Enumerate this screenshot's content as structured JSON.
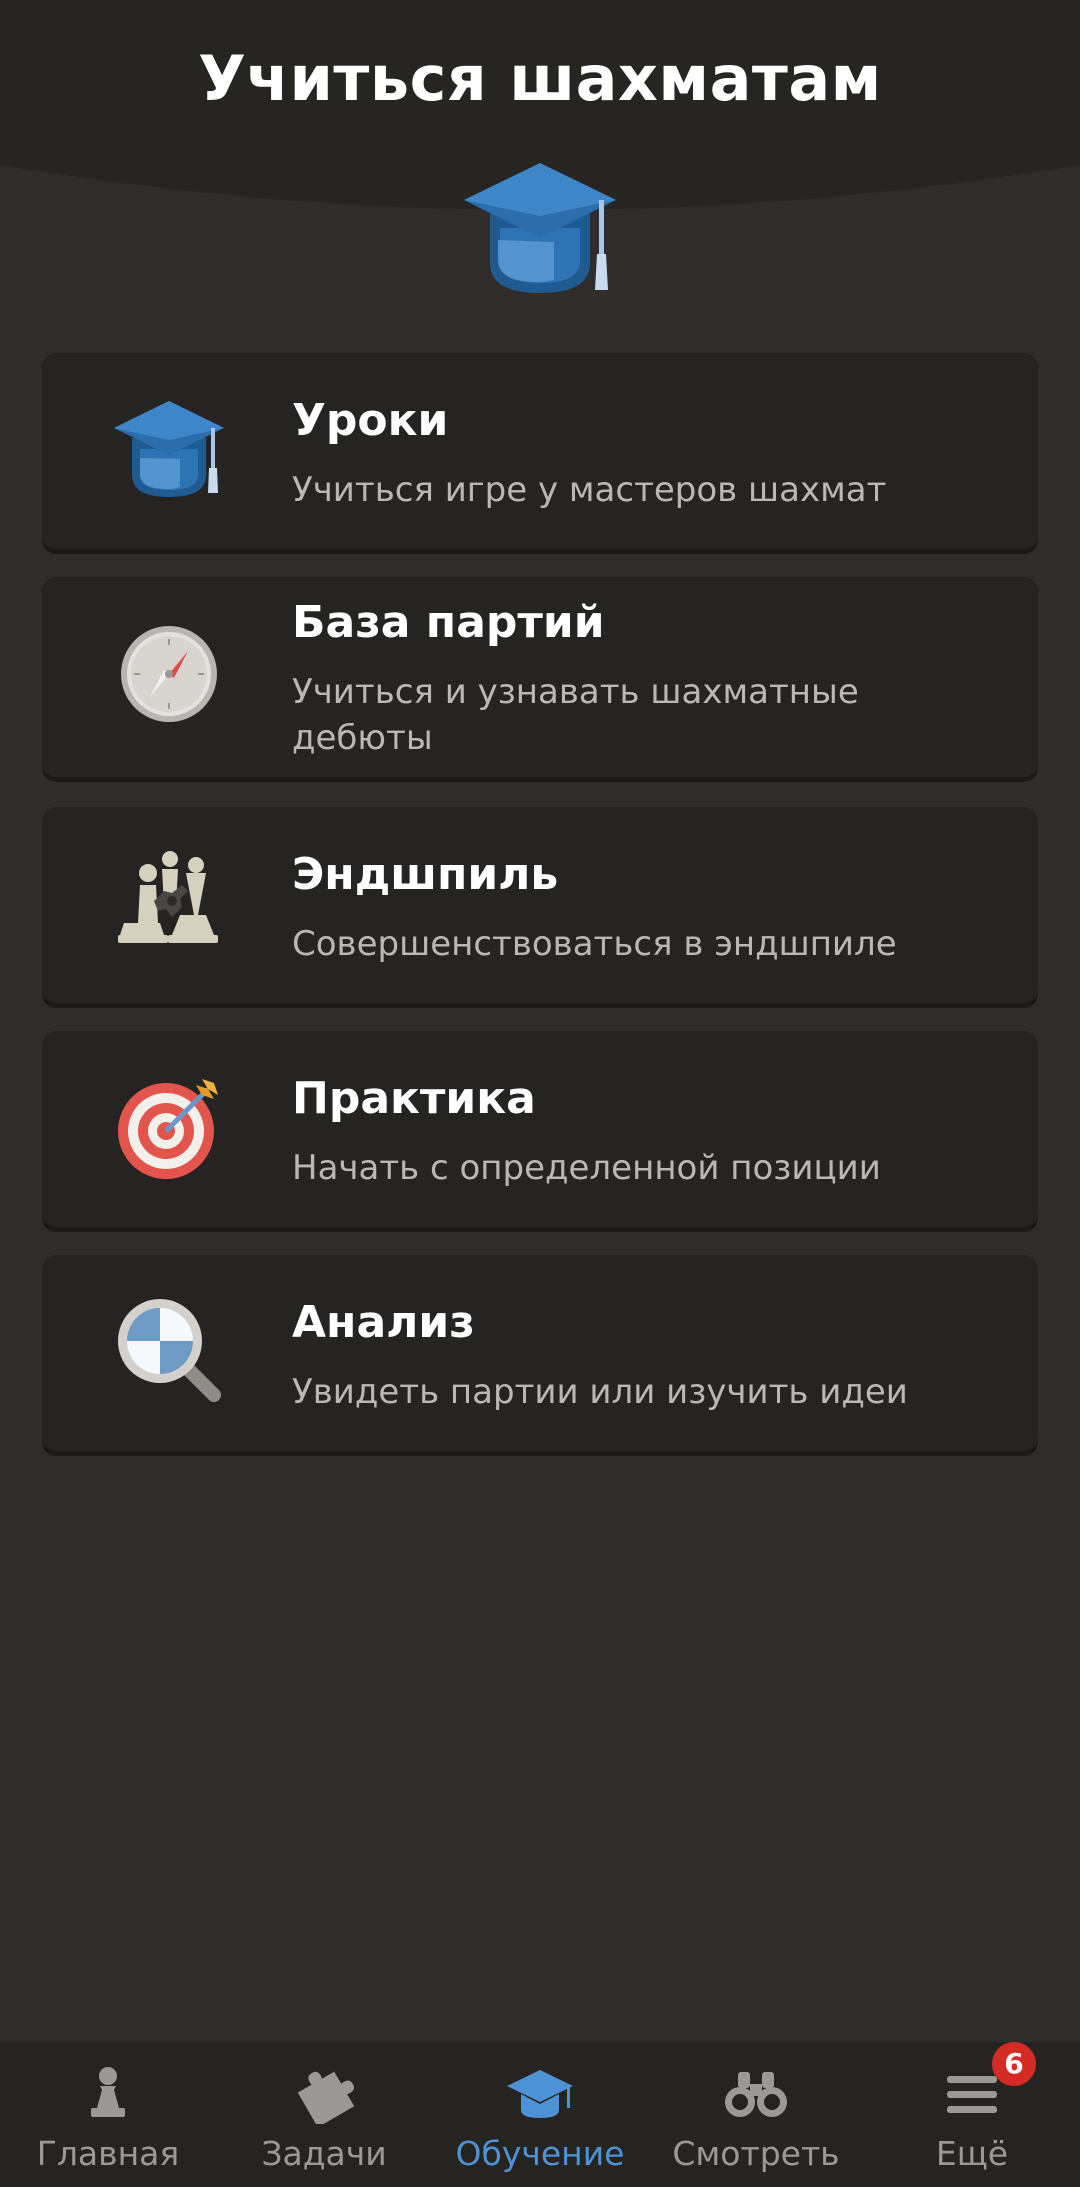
{
  "header": {
    "title": "Учиться шахматам",
    "icon": "graduation-cap-icon"
  },
  "cards": [
    {
      "title": "Уроки",
      "description": "Учиться игре у мастеров шахмат",
      "icon": "graduation-cap-icon"
    },
    {
      "title": "База партий",
      "description": "Учиться и узнавать шахматные дебюты",
      "icon": "compass-icon"
    },
    {
      "title": "Эндшпиль",
      "description": "Совершенствоваться в эндшпиле",
      "icon": "chess-pieces-icon"
    },
    {
      "title": "Практика",
      "description": "Начать с определенной позиции",
      "icon": "target-icon"
    },
    {
      "title": "Анализ",
      "description": "Увидеть партии или изучить идеи",
      "icon": "magnifier-icon"
    }
  ],
  "tabbar": {
    "active": "Обучение",
    "tabs": [
      {
        "label": "Главная",
        "icon": "pawn-icon"
      },
      {
        "label": "Задачи",
        "icon": "puzzle-icon"
      },
      {
        "label": "Обучение",
        "icon": "graduation-cap-icon"
      },
      {
        "label": "Смотреть",
        "icon": "binoculars-icon"
      },
      {
        "label": "Ещё",
        "icon": "menu-icon",
        "badge": "6"
      }
    ]
  },
  "colors": {
    "background": "#302c29",
    "header_background": "#272522",
    "card_background": "#262422",
    "accent_blue": "#4c92d4",
    "badge_red": "#d42b25",
    "muted_text": "#bab8b5"
  }
}
